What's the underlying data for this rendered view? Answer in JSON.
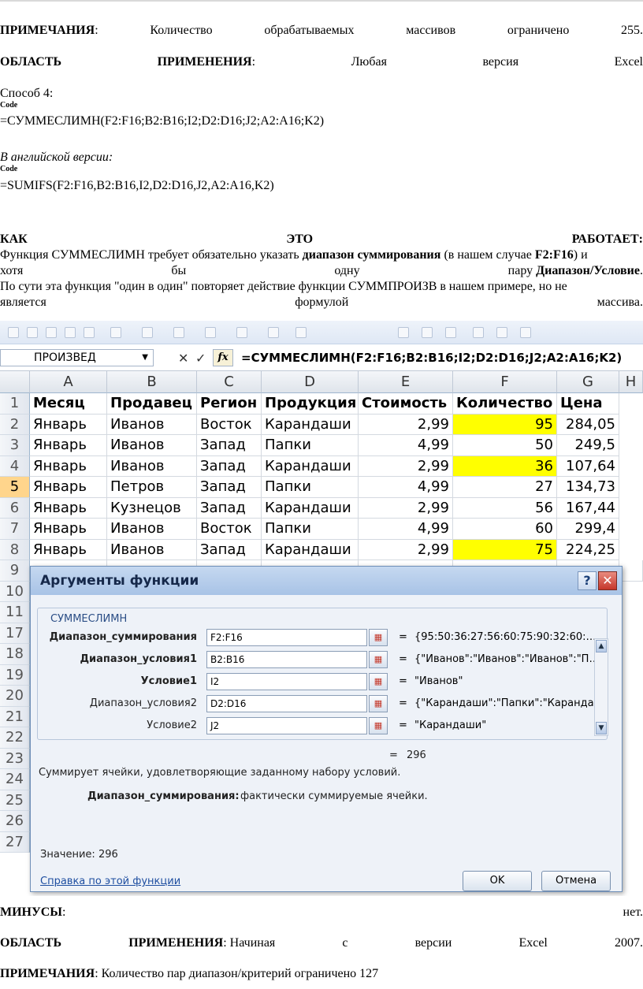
{
  "top": {
    "notes_label": "ПРИМЕЧАНИЯ",
    "notes_words": [
      "Количество",
      "обрабатываемых",
      "массивов",
      "ограничено",
      "255."
    ],
    "area_label_1": "ОБЛАСТЬ",
    "area_label_2": "ПРИМЕНЕНИЯ",
    "area_words": [
      "Любая",
      "версия",
      "Excel"
    ]
  },
  "method": {
    "title": "Способ 4:",
    "code_tag": "Code",
    "formula_ru": "=СУММЕСЛИМН(F2:F16;B2:B16;I2;D2:D16;J2;A2:A16;K2)",
    "english_label": "В английской версии:",
    "formula_en": "=SUMIFS(F2:F16,B2:B16,I2,D2:D16,J2,A2:A16,K2)"
  },
  "how": {
    "heading_words": [
      "КАК",
      "ЭТО",
      "РАБОТАЕТ:"
    ],
    "line1_a": "Функция СУММЕСЛИМН требует обязательно указать ",
    "line1_b": "диапазон суммирования",
    "line1_c": " (в нашем случае ",
    "line1_d": "F2:F16",
    "line1_e": ") и",
    "line2_words": [
      "хотя",
      "бы",
      "одну"
    ],
    "line2_tail_a": "пару ",
    "line2_tail_b": "Диапазон/Условие",
    "line2_tail_c": ".",
    "line3": "По сути эта функция \"один в один\" повторяет действие функции СУММПРОИЗВ в нашем примере, но не",
    "line4_words": [
      "является",
      "формулой",
      "массива."
    ]
  },
  "excel": {
    "name_box": "ПРОИЗВЕД",
    "cancel_glyph": "✕",
    "enter_glyph": "✓",
    "fx_label": "fx",
    "formula": "=СУММЕСЛИМН(F2:F16;B2:B16;I2;D2:D16;J2;A2:A16;K2)",
    "columns": [
      "A",
      "B",
      "C",
      "D",
      "E",
      "F",
      "G",
      "H"
    ],
    "row_numbers": [
      "1",
      "2",
      "3",
      "4",
      "5",
      "6",
      "7",
      "8",
      "9",
      "10",
      "11",
      "17",
      "18",
      "19",
      "20",
      "21",
      "22",
      "23",
      "24",
      "25",
      "26",
      "27"
    ],
    "header_row": [
      "Месяц",
      "Продавец",
      "Регион",
      "Продукция",
      "Стоимость",
      "Количество",
      "Цена"
    ],
    "rows": [
      [
        "Январь",
        "Иванов",
        "Восток",
        "Карандаши",
        "2,99",
        "95",
        "284,05"
      ],
      [
        "Январь",
        "Иванов",
        "Запад",
        "Папки",
        "4,99",
        "50",
        "249,5"
      ],
      [
        "Январь",
        "Иванов",
        "Запад",
        "Карандаши",
        "2,99",
        "36",
        "107,64"
      ],
      [
        "Январь",
        "Петров",
        "Запад",
        "Папки",
        "4,99",
        "27",
        "134,73"
      ],
      [
        "Январь",
        "Кузнецов",
        "Запад",
        "Карандаши",
        "2,99",
        "56",
        "167,44"
      ],
      [
        "Январь",
        "Иванов",
        "Восток",
        "Папки",
        "4,99",
        "60",
        "299,4"
      ],
      [
        "Январь",
        "Иванов",
        "Запад",
        "Карандаши",
        "2,99",
        "75",
        "224,25"
      ]
    ],
    "highlight_color": "#ffff00",
    "dialog": {
      "title": "Аргументы функции",
      "help_glyph": "?",
      "close_glyph": "✕",
      "group": "СУММЕСЛИМН",
      "args": [
        {
          "label": "Диапазон_суммирования",
          "value": "F2:F16",
          "result": "{95:50:36:27:56:60:75:90:32:60:…"
        },
        {
          "label": "Диапазон_условия1",
          "value": "B2:B16",
          "result": "{\"Иванов\":\"Иванов\":\"Иванов\":\"П…"
        },
        {
          "label": "Условие1",
          "value": "I2",
          "result": "\"Иванов\""
        },
        {
          "label": "Диапазон_условия2",
          "value": "D2:D16",
          "result": "{\"Карандаши\":\"Папки\":\"Каранда…"
        },
        {
          "label": "Условие2",
          "value": "J2",
          "result": "\"Карандаши\""
        }
      ],
      "eq": "=",
      "total": "296",
      "description": "Суммирует ячейки, удовлетворяющие заданному набору условий.",
      "arg_help_label": "Диапазон_суммирования:",
      "arg_help_text": "фактически суммируемые ячейки.",
      "value_label": "Значение:",
      "value": "296",
      "help_link": "Справка по этой функции",
      "ok": "OK",
      "cancel": "Отмена"
    }
  },
  "bottom": {
    "minus_label": "МИНУСЫ",
    "minus_value": "нет.",
    "area_label_1": "ОБЛАСТЬ",
    "area_label_2": "ПРИМЕНЕНИЯ",
    "area_words": [
      "Начиная",
      "с",
      "версии",
      "Excel",
      "2007."
    ],
    "notes_label": "ПРИМЕЧАНИЯ",
    "notes_text": "Количество пар диапазон/критерий ограничено 127"
  }
}
